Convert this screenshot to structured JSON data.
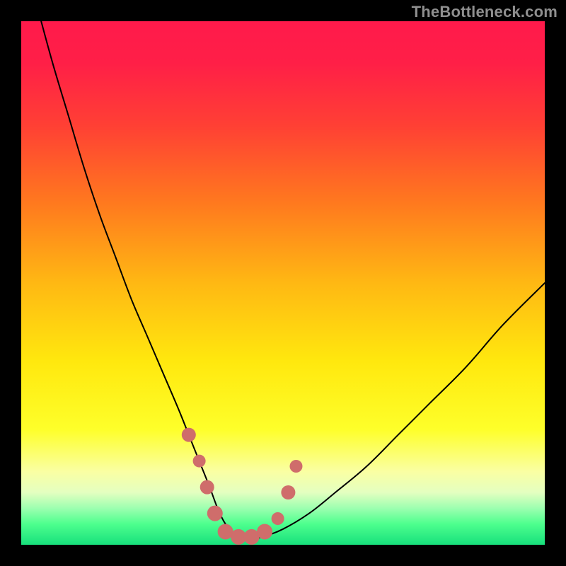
{
  "watermark": "TheBottleneck.com",
  "chart_data": {
    "type": "line",
    "title": "",
    "xlabel": "",
    "ylabel": "",
    "xlim": [
      0,
      100
    ],
    "ylim": [
      0,
      100
    ],
    "background": {
      "stops": [
        {
          "offset": 0.0,
          "color": "#ff1a4b"
        },
        {
          "offset": 0.08,
          "color": "#ff1f47"
        },
        {
          "offset": 0.2,
          "color": "#ff4034"
        },
        {
          "offset": 0.35,
          "color": "#ff7a1e"
        },
        {
          "offset": 0.5,
          "color": "#ffb813"
        },
        {
          "offset": 0.65,
          "color": "#ffe80e"
        },
        {
          "offset": 0.78,
          "color": "#feff2a"
        },
        {
          "offset": 0.86,
          "color": "#faffa3"
        },
        {
          "offset": 0.9,
          "color": "#e4ffc0"
        },
        {
          "offset": 0.93,
          "color": "#9dffb0"
        },
        {
          "offset": 0.96,
          "color": "#4eff8e"
        },
        {
          "offset": 1.0,
          "color": "#17e07c"
        }
      ]
    },
    "series": [
      {
        "name": "bottleneck-curve",
        "stroke": "#000000",
        "stroke_width": 2,
        "x": [
          3,
          6,
          9,
          12,
          15,
          18,
          21,
          24,
          27,
          30,
          32,
          34,
          36,
          37.5,
          39,
          41,
          43,
          46,
          50,
          55,
          60,
          66,
          72,
          78,
          85,
          92,
          100
        ],
        "y": [
          103,
          92,
          82,
          72,
          63,
          55,
          47,
          40,
          33,
          26,
          21,
          16,
          11,
          7,
          4,
          2,
          1,
          1.5,
          3,
          6,
          10,
          15,
          21,
          27,
          34,
          42,
          50
        ]
      }
    ],
    "markers": {
      "color": "#cf6d6b",
      "points": [
        {
          "x": 32.0,
          "y": 21.0,
          "r": 10
        },
        {
          "x": 34.0,
          "y": 16.0,
          "r": 9
        },
        {
          "x": 35.5,
          "y": 11.0,
          "r": 10
        },
        {
          "x": 37.0,
          "y": 6.0,
          "r": 11
        },
        {
          "x": 39.0,
          "y": 2.5,
          "r": 11
        },
        {
          "x": 41.5,
          "y": 1.5,
          "r": 11
        },
        {
          "x": 44.0,
          "y": 1.5,
          "r": 11
        },
        {
          "x": 46.5,
          "y": 2.5,
          "r": 11
        },
        {
          "x": 49.0,
          "y": 5.0,
          "r": 9
        },
        {
          "x": 51.0,
          "y": 10.0,
          "r": 10
        },
        {
          "x": 52.5,
          "y": 15.0,
          "r": 9
        }
      ]
    }
  }
}
